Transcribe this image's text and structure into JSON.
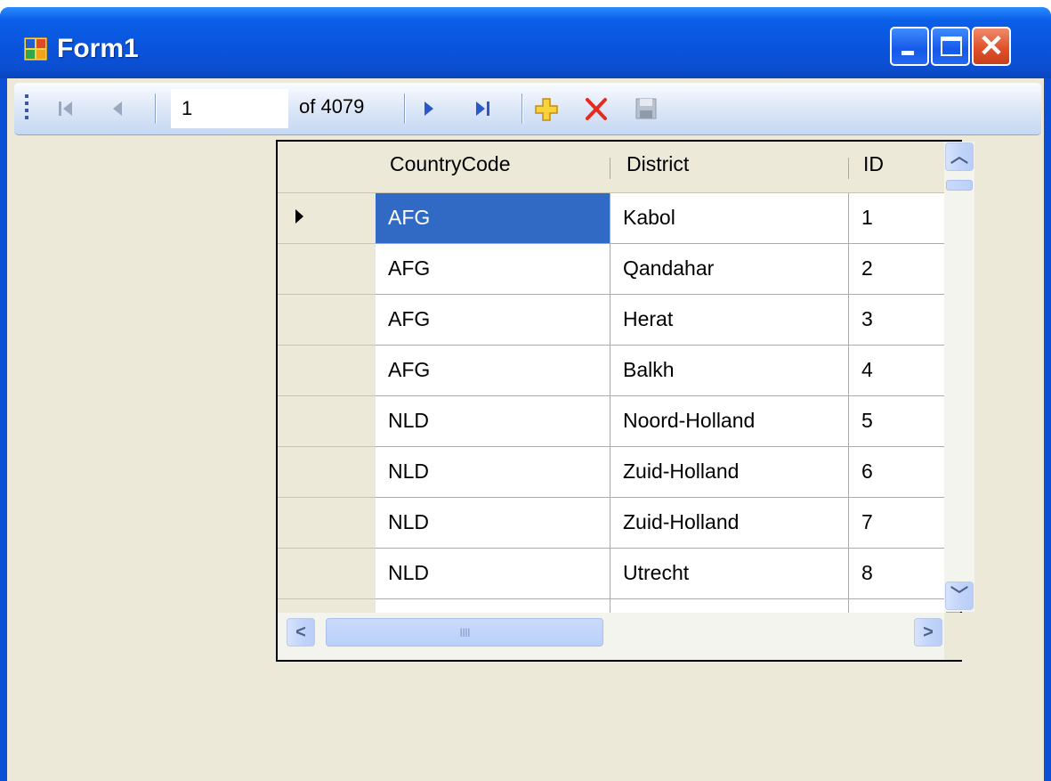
{
  "window": {
    "title": "Form1"
  },
  "navigator": {
    "position": "1",
    "count_label": "of 4079",
    "icons": [
      "move-first-icon",
      "move-previous-icon",
      "move-next-icon",
      "move-last-icon",
      "add-new-icon",
      "delete-icon",
      "save-icon"
    ]
  },
  "grid": {
    "columns": [
      "CountryCode",
      "District",
      "ID"
    ],
    "rows": [
      [
        "AFG",
        "Kabol",
        "1"
      ],
      [
        "AFG",
        "Qandahar",
        "2"
      ],
      [
        "AFG",
        "Herat",
        "3"
      ],
      [
        "AFG",
        "Balkh",
        "4"
      ],
      [
        "NLD",
        "Noord-Holland",
        "5"
      ],
      [
        "NLD",
        "Zuid-Holland",
        "6"
      ],
      [
        "NLD",
        "Zuid-Holland",
        "7"
      ],
      [
        "NLD",
        "Utrecht",
        "8"
      ]
    ],
    "selected_row": 0,
    "selected_column": 0
  },
  "colors": {
    "selection": "#316ac5",
    "title_bar": "#0a54dd",
    "client": "#ece9d8"
  }
}
